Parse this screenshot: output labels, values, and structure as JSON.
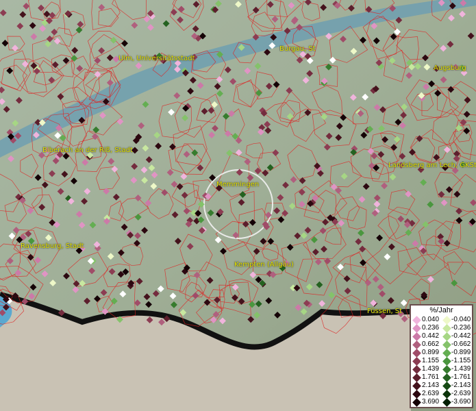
{
  "map": {
    "cities": [
      {
        "name": "Ulm, Universitätsstadt"
      },
      {
        "name": "Burgau, St"
      },
      {
        "name": "Augsburg"
      },
      {
        "name": "Biberach an der Riß, Stadt"
      },
      {
        "name": "Landsberg am Lech, GKSt"
      },
      {
        "name": "Memmingen"
      },
      {
        "name": "Ravensburg, Stadt"
      },
      {
        "name": "Kempten (Allgäu)"
      },
      {
        "name": "Füssen, St"
      }
    ]
  },
  "legend": {
    "title": "%/Jahr",
    "positive": [
      {
        "label": "0.040",
        "color": "#f0b4dc"
      },
      {
        "label": "0.236",
        "color": "#e094c4"
      },
      {
        "label": "0.442",
        "color": "#cc7aa8"
      },
      {
        "label": "0.662",
        "color": "#b0607e"
      },
      {
        "label": "0.899",
        "color": "#a04c68"
      },
      {
        "label": "1.155",
        "color": "#8c3c52"
      },
      {
        "label": "1.439",
        "color": "#742c3e"
      },
      {
        "label": "1.761",
        "color": "#5c1e2c"
      },
      {
        "label": "2.143",
        "color": "#44121c"
      },
      {
        "label": "2.639",
        "color": "#2c0810"
      },
      {
        "label": "3.690",
        "color": "#140206"
      }
    ],
    "negative": [
      {
        "label": "-0.040",
        "color": "#eef8c8"
      },
      {
        "label": "-0.236",
        "color": "#c8e8a0"
      },
      {
        "label": "-0.442",
        "color": "#a6d684"
      },
      {
        "label": "-0.662",
        "color": "#84c26a"
      },
      {
        "label": "-0.899",
        "color": "#64ae52"
      },
      {
        "label": "-1.155",
        "color": "#4a963e"
      },
      {
        "label": "-1.439",
        "color": "#367c2e"
      },
      {
        "label": "-1.761",
        "color": "#246220"
      },
      {
        "label": "-2.143",
        "color": "#164a14"
      },
      {
        "label": "-2.639",
        "color": "#0c340a"
      },
      {
        "label": "-3.690",
        "color": "#041e04"
      }
    ]
  }
}
